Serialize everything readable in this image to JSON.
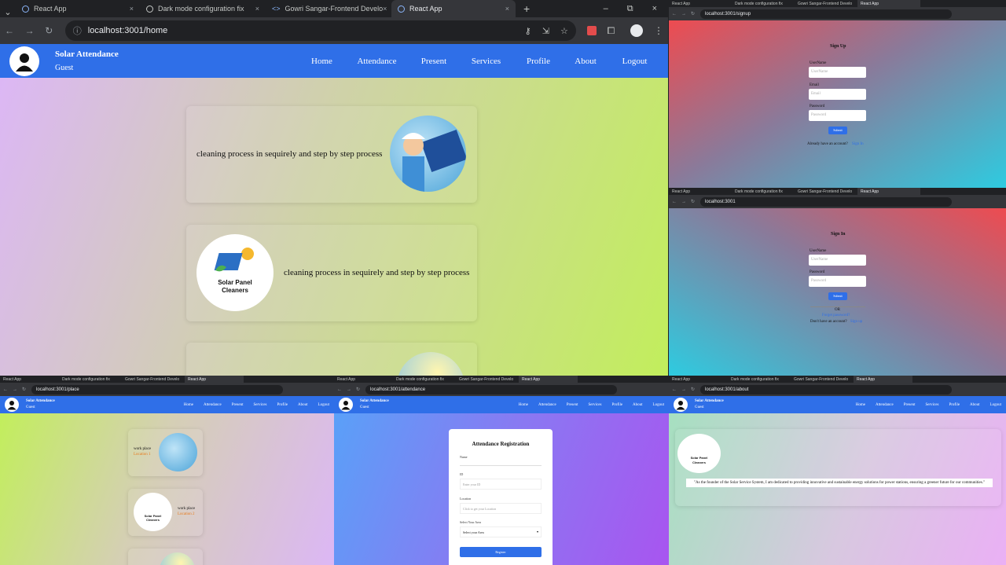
{
  "main": {
    "tabs": [
      {
        "label": "React App"
      },
      {
        "label": "Dark mode configuration fix"
      },
      {
        "label": "Gowri Sangar-Frontend Develo"
      },
      {
        "label": "React App"
      }
    ],
    "url": "localhost:3001/home",
    "app": {
      "brand": "Solar Attendance",
      "user": "Guest"
    },
    "nav": [
      "Home",
      "Attendance",
      "Present",
      "Services",
      "Profile",
      "About",
      "Logout"
    ],
    "cards": [
      {
        "text": "cleaning process in sequirely and step by step process"
      },
      {
        "text": "cleaning process in sequirely and step by step process"
      }
    ],
    "logo": {
      "line1": "Solar Panel",
      "line2": "Cleaners"
    }
  },
  "signup": {
    "url": "localhost:3001/signup",
    "title": "Sign Up",
    "username_label": "UserName",
    "username_placeholder": "UserName",
    "email_label": "Email",
    "email_placeholder": "Email",
    "password_label": "Password",
    "password_placeholder": "Password",
    "submit": "Submit",
    "footer_text": "Already have an account?",
    "footer_link": "Sign In"
  },
  "signin": {
    "url": "localhost:3001",
    "title": "Sign In",
    "username_label": "UserName",
    "username_placeholder": "UserName",
    "password_label": "Password",
    "password_placeholder": "Password",
    "submit": "Submit",
    "or": "OR",
    "forgot": "Forget password?",
    "footer_text": "Don't have an account?",
    "footer_link": "Sign up"
  },
  "place": {
    "url": "localhost:3001/place",
    "items": [
      {
        "title": "work place",
        "location": "Location 1"
      },
      {
        "title": "work place",
        "location": "Location 2"
      }
    ]
  },
  "attendance": {
    "url": "localhost:3001/attendance",
    "title": "Attendance Registration",
    "name_label": "Name",
    "id_label": "ID",
    "id_placeholder": "Enter your ID",
    "location_label": "Location",
    "location_placeholder": "Click to get your Location",
    "area_label": "Select Your Area",
    "area_value": "Select your Area",
    "register": "Register"
  },
  "about": {
    "url": "localhost:3001/about",
    "quote": "\"As the founder of the Solar Service System, I am dedicated to providing innovative and sustainable energy solutions for power stations, ensuring a greener future for our communities.\""
  },
  "colors": {
    "nav_blue": "#2f6fe8",
    "orange_location": "#e87a1c"
  }
}
